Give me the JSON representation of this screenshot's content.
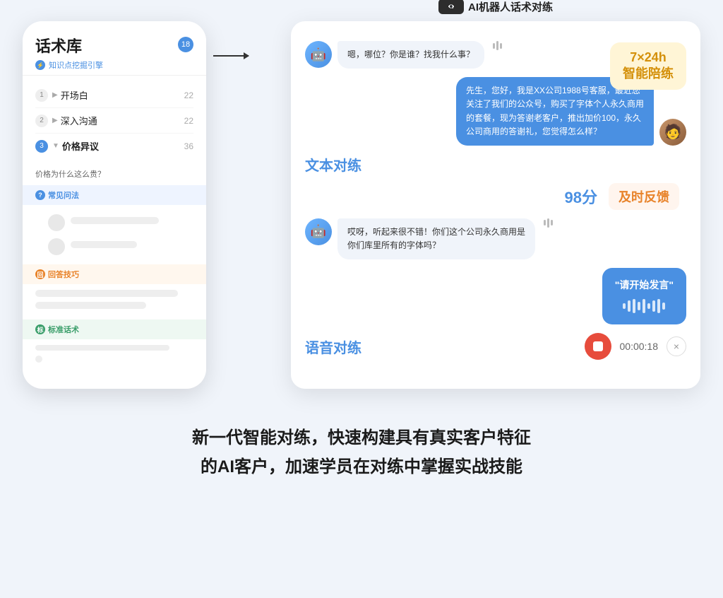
{
  "page": {
    "background_color": "#f0f4fa"
  },
  "left_panel": {
    "title": "话术库",
    "subtitle": "知识点挖掘引擎",
    "badge": "18",
    "nav_items": [
      {
        "num": "1",
        "arrow": "▶",
        "label": "开场白",
        "count": "22",
        "active": false
      },
      {
        "num": "2",
        "arrow": "▶",
        "label": "深入沟通",
        "count": "22",
        "active": false
      },
      {
        "num": "3",
        "arrow": "▼",
        "label": "价格异议",
        "count": "36",
        "active": true
      }
    ],
    "price_question": "价格为什么这么贵？",
    "sections": [
      {
        "type": "blue",
        "label": "常见问法",
        "icon": "?"
      },
      {
        "type": "orange",
        "label": "回答技巧",
        "icon": "回"
      },
      {
        "type": "green",
        "label": "标准话术",
        "icon": "标"
      }
    ]
  },
  "right_panel": {
    "arrow_label": "AI机器人话术对练",
    "tag_7x24": "7×24h\n智能陪练",
    "tag_wenben": "文本对练",
    "tag_98": "98分",
    "tag_jishi": "及时反馈",
    "tag_yuyin": "语音对练",
    "timer": "00:00:18",
    "messages": [
      {
        "type": "bot",
        "text": "嗯，哪位？你是谁？找我什么事？",
        "has_sound": true
      },
      {
        "type": "user",
        "text": "先生，您好，我是XX公司1988号客服，最近您关注了我们的公众号，购买了字体个人永久商用的套餐，现为答谢老客户，推出加价100，永久公司商用的答谢礼，您觉得怎么样？"
      },
      {
        "type": "bot",
        "text": "哎呀，听起来很不错！你们这个公司永久商用是你们库里所有的字体吗？",
        "has_sound": true
      },
      {
        "type": "voice_bubble",
        "text": "\"请开始发言\""
      }
    ],
    "voice_controls": {
      "timer": "00:00:18",
      "close": "×"
    }
  },
  "bottom_text": {
    "line1": "新一代智能对练，快速构建具有真实客户特征",
    "line2": "的AI客户，加速学员在对练中掌握实战技能"
  }
}
